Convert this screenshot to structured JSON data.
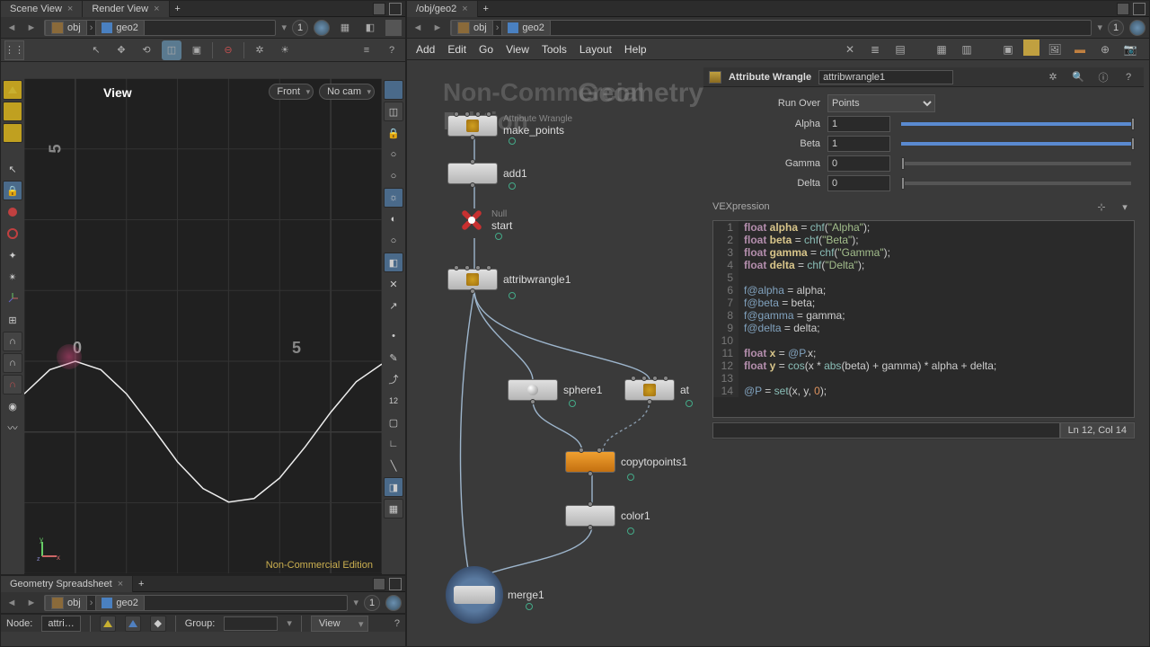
{
  "left": {
    "tabs": [
      "Scene View",
      "Render View"
    ],
    "breadcrumb": {
      "obj": "obj",
      "geo": "geo2",
      "one": "1"
    },
    "view": {
      "title": "View",
      "cam1": "Front",
      "cam2": "No cam",
      "watermark": "Non-Commercial Edition",
      "axis_x": "5",
      "axis_y": "5",
      "axis_zero": "0"
    },
    "spreadsheet_tab": "Geometry Spreadsheet",
    "ss_path": {
      "obj": "obj",
      "geo": "geo2",
      "one": "1"
    },
    "bottom": {
      "nodelabel": "Node:",
      "nodeval": "attri…",
      "grouplabel": "Group:",
      "viewbtn": "View"
    }
  },
  "right": {
    "tab": "/obj/geo2",
    "breadcrumb": {
      "obj": "obj",
      "geo": "geo2",
      "one": "1"
    },
    "menus": [
      "Add",
      "Edit",
      "Go",
      "View",
      "Tools",
      "Layout",
      "Help"
    ],
    "watermark_left": "Non-Commercial Edition",
    "watermark_right": "Geometry",
    "nodes": {
      "make_points": {
        "type": "Attribute Wrangle",
        "label": "make_points"
      },
      "add1": "add1",
      "start": {
        "type": "Null",
        "label": "start"
      },
      "attribwrangle1": "attribwrangle1",
      "sphere1": "sphere1",
      "at": "at",
      "copytopoints1": "copytopoints1",
      "color1": "color1",
      "merge1": "merge1"
    }
  },
  "parms": {
    "optype": "Attribute Wrangle",
    "opname": "attribwrangle1",
    "runover_label": "Run Over",
    "runover_value": "Points",
    "params": [
      {
        "label": "Alpha",
        "value": "1",
        "fill": 100
      },
      {
        "label": "Beta",
        "value": "1",
        "fill": 100
      },
      {
        "label": "Gamma",
        "value": "0",
        "fill": 0
      },
      {
        "label": "Delta",
        "value": "0",
        "fill": 0
      }
    ],
    "vex_label": "VEXpression",
    "status": "Ln 12, Col 14",
    "code": [
      [
        [
          "kw",
          "float "
        ],
        [
          "id",
          "alpha"
        ],
        [
          "",
          " = "
        ],
        [
          "fn",
          "chf"
        ],
        [
          "",
          "("
        ],
        [
          "str",
          "\"Alpha\""
        ],
        [
          "",
          ");"
        ]
      ],
      [
        [
          "kw",
          "float "
        ],
        [
          "id",
          "beta"
        ],
        [
          "",
          " = "
        ],
        [
          "fn",
          "chf"
        ],
        [
          "",
          "("
        ],
        [
          "str",
          "\"Beta\""
        ],
        [
          "",
          ");"
        ]
      ],
      [
        [
          "kw",
          "float "
        ],
        [
          "id",
          "gamma"
        ],
        [
          "",
          " = "
        ],
        [
          "fn",
          "chf"
        ],
        [
          "",
          "("
        ],
        [
          "str",
          "\"Gamma\""
        ],
        [
          "",
          ");"
        ]
      ],
      [
        [
          "kw",
          "float "
        ],
        [
          "id",
          "delta"
        ],
        [
          "",
          " = "
        ],
        [
          "fn",
          "chf"
        ],
        [
          "",
          "("
        ],
        [
          "str",
          "\"Delta\""
        ],
        [
          "",
          ");"
        ]
      ],
      [
        [
          "",
          ""
        ]
      ],
      [
        [
          "at",
          "f@alpha"
        ],
        [
          "",
          " = alpha;"
        ]
      ],
      [
        [
          "at",
          "f@beta"
        ],
        [
          "",
          " = beta;"
        ]
      ],
      [
        [
          "at",
          "f@gamma"
        ],
        [
          "",
          " = gamma;"
        ]
      ],
      [
        [
          "at",
          "f@delta"
        ],
        [
          "",
          " = delta;"
        ]
      ],
      [
        [
          "",
          ""
        ]
      ],
      [
        [
          "kw",
          "float "
        ],
        [
          "id",
          "x"
        ],
        [
          "",
          " = "
        ],
        [
          "at",
          "@P"
        ],
        [
          "",
          ".x;"
        ]
      ],
      [
        [
          "kw",
          "float "
        ],
        [
          "id",
          "y"
        ],
        [
          "",
          " = "
        ],
        [
          "fn",
          "cos"
        ],
        [
          "",
          "(x * "
        ],
        [
          "fn",
          "abs"
        ],
        [
          "",
          "(beta) + gamma) * alpha + delta;"
        ]
      ],
      [
        [
          "",
          ""
        ]
      ],
      [
        [
          "at",
          "@P"
        ],
        [
          "",
          " = "
        ],
        [
          "fn",
          "set"
        ],
        [
          "",
          "(x, y, "
        ],
        [
          "num",
          "0"
        ],
        [
          "",
          ");"
        ]
      ]
    ]
  },
  "chart_data": {
    "type": "line",
    "title": "View",
    "xlabel": "",
    "ylabel": "",
    "xlim": [
      -1,
      6
    ],
    "ylim": [
      -2,
      5
    ],
    "x": [
      -1,
      -0.5,
      0,
      0.5,
      1,
      1.5,
      2,
      2.5,
      3,
      3.5,
      4,
      4.5,
      5,
      5.5,
      6
    ],
    "values": [
      0.54,
      0.88,
      1.0,
      0.88,
      0.54,
      0.07,
      -0.42,
      -0.8,
      -0.99,
      -0.94,
      -0.65,
      -0.21,
      0.28,
      0.71,
      0.96
    ],
    "annotations": [
      "Non-Commercial Edition"
    ],
    "series": [
      {
        "name": "cos(x*|beta|+gamma)*alpha+delta",
        "formula": "alpha=1,beta=1,gamma=0,delta=0"
      }
    ]
  }
}
